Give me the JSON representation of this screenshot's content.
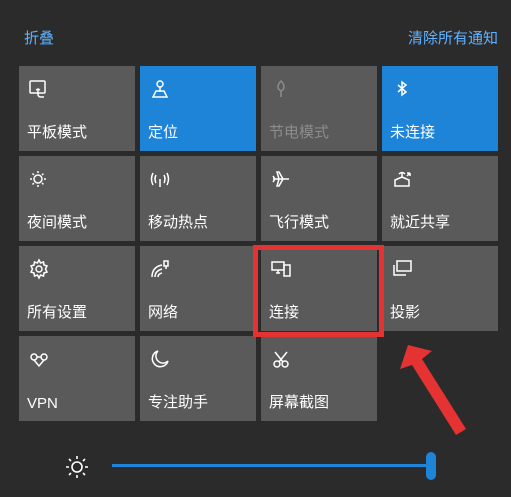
{
  "header": {
    "collapse_label": "折叠",
    "clear_label": "清除所有通知"
  },
  "tiles": [
    {
      "label": "平板模式",
      "icon": "tablet-mode-icon",
      "state": "off"
    },
    {
      "label": "定位",
      "icon": "location-icon",
      "state": "on"
    },
    {
      "label": "节电模式",
      "icon": "battery-saver-icon",
      "state": "disabled"
    },
    {
      "label": "未连接",
      "icon": "bluetooth-icon",
      "state": "on"
    },
    {
      "label": "夜间模式",
      "icon": "night-light-icon",
      "state": "off"
    },
    {
      "label": "移动热点",
      "icon": "mobile-hotspot-icon",
      "state": "off"
    },
    {
      "label": "飞行模式",
      "icon": "airplane-icon",
      "state": "off"
    },
    {
      "label": "就近共享",
      "icon": "nearby-share-icon",
      "state": "off"
    },
    {
      "label": "所有设置",
      "icon": "settings-gear-icon",
      "state": "off"
    },
    {
      "label": "网络",
      "icon": "network-icon",
      "state": "off"
    },
    {
      "label": "连接",
      "icon": "connect-icon",
      "state": "off"
    },
    {
      "label": "投影",
      "icon": "project-icon",
      "state": "off"
    },
    {
      "label": "VPN",
      "icon": "vpn-icon",
      "state": "off"
    },
    {
      "label": "专注助手",
      "icon": "focus-assist-moon-icon",
      "state": "off"
    },
    {
      "label": "屏幕截图",
      "icon": "screen-snip-icon",
      "state": "off"
    }
  ],
  "brightness": {
    "icon": "brightness-sun-icon",
    "level_percent": 100
  },
  "colors": {
    "background": "#2b2b2b",
    "tile": "#5a5a5a",
    "accent": "#1e84d8",
    "link": "#5fb2ff",
    "highlight": "#e53232"
  }
}
